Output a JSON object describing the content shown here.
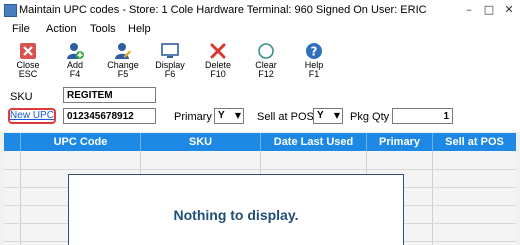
{
  "window": {
    "title": "Maintain UPC codes  - Store: 1   Cole Hardware   Terminal: 960   Signed On User: ERIC"
  },
  "menu": [
    "File",
    "Action",
    "Tools",
    "Help"
  ],
  "toolbar": [
    {
      "line1": "Close",
      "line2": "ESC",
      "icon": "close-icon"
    },
    {
      "line1": "Add",
      "line2": "F4",
      "icon": "add-user-icon"
    },
    {
      "line1": "Change",
      "line2": "F5",
      "icon": "edit-user-icon"
    },
    {
      "line1": "Display",
      "line2": "F6",
      "icon": "monitor-icon"
    },
    {
      "line1": "Delete",
      "line2": "F10",
      "icon": "delete-x-icon"
    },
    {
      "line1": "Clear",
      "line2": "F12",
      "icon": "clear-circle-icon"
    },
    {
      "line1": "Help",
      "line2": "F1",
      "icon": "help-icon"
    }
  ],
  "form": {
    "sku_label": "SKU",
    "sku_value": "REGITEM",
    "new_upc_link": "New UPC",
    "upc_value": "012345678912",
    "primary_label": "Primary",
    "primary_value": "Y",
    "sell_at_pos_label": "Sell at POS",
    "sell_at_pos_value": "Y",
    "pkg_qty_label": "Pkg Qty",
    "pkg_qty_value": "1"
  },
  "grid": {
    "columns": [
      "UPC Code",
      "SKU",
      "Date Last Used",
      "Primary",
      "Sell at POS"
    ],
    "empty_message": "Nothing to display."
  },
  "colors": {
    "header_blue": "#1e88e5",
    "link_blue": "#1a5bd6",
    "highlight_red": "#e03a3a"
  }
}
